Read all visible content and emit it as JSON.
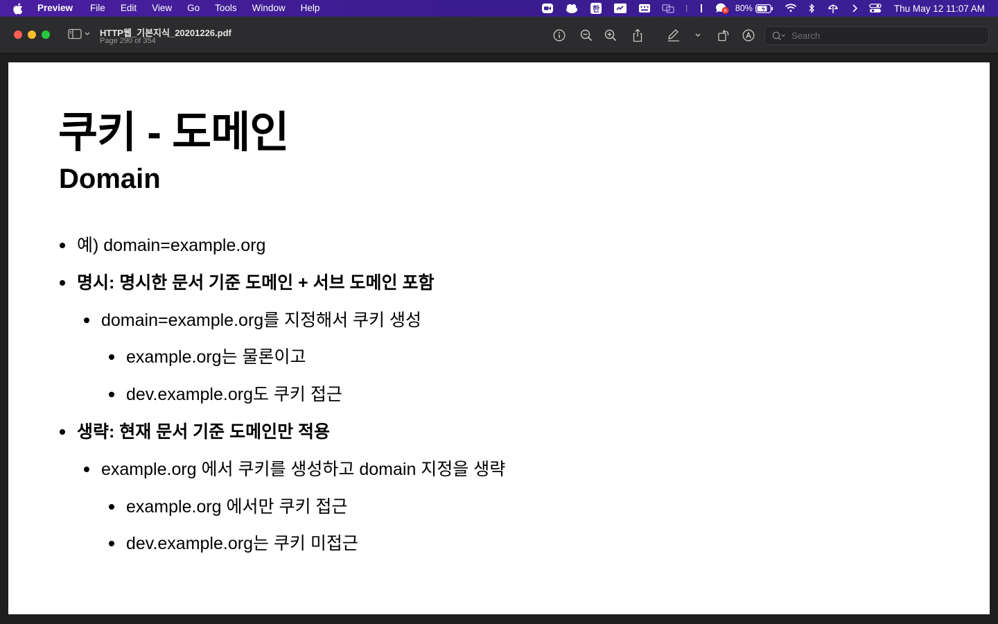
{
  "menubar": {
    "app_name": "Preview",
    "items": [
      "File",
      "Edit",
      "View",
      "Go",
      "Tools",
      "Window",
      "Help"
    ],
    "battery_percent": "80%",
    "clock": "Thu May 12  11:07 AM"
  },
  "window": {
    "doc_title": "HTTP웹_기본지식_20201226.pdf",
    "page_indicator": "Page 290 of 354",
    "search_placeholder": "Search"
  },
  "slide": {
    "title": "쿠키 - 도메인",
    "subtitle": "Domain",
    "bullets": [
      "예) domain=example.org",
      "명시: 명시한 문서 기준 도메인 + 서브 도메인 포함",
      "domain=example.org를 지정해서 쿠키 생성",
      "example.org는 물론이고",
      "dev.example.org도 쿠키 접근",
      "생략: 현재 문서 기준 도메인만 적용",
      "example.org 에서 쿠키를 생성하고 domain 지정을 생략",
      "example.org 에서만 쿠키 접근",
      "dev.example.org는 쿠키 미접근"
    ]
  },
  "colors": {
    "menubar": "#3b1c8f",
    "toolbar": "#2c2c2e",
    "page": "#ffffff",
    "close": "#ff5f57",
    "minimize": "#febc2e",
    "zoom": "#28c840"
  }
}
